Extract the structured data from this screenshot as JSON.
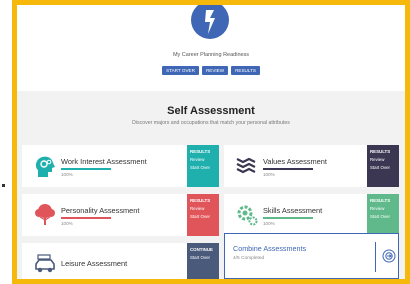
{
  "header": {
    "title": "My Career Planning Readiness",
    "buttons": [
      "START OVER",
      "REVIEW",
      "RESULTS"
    ]
  },
  "section": {
    "title": "Self Assessment",
    "subtitle": "Discover majors and occupations that match your personal attributes"
  },
  "cards": [
    {
      "name": "Work Interest Assessment",
      "pct": "100%",
      "side": [
        "RESULTS",
        "Review",
        "Start Over"
      ],
      "side_color": "#1fb0ad",
      "bar_color": "#1fb0ad"
    },
    {
      "name": "Values Assessment",
      "pct": "100%",
      "side": [
        "RESULTS",
        "Review",
        "Start Over"
      ],
      "side_color": "#3b3752",
      "bar_color": "#3b3752"
    },
    {
      "name": "Personality Assessment",
      "pct": "100%",
      "side": [
        "RESULTS",
        "Review",
        "Start Over"
      ],
      "side_color": "#e0555a",
      "bar_color": "#e0555a"
    },
    {
      "name": "Skills Assessment",
      "pct": "100%",
      "side": [
        "RESULTS",
        "Review",
        "Start Over"
      ],
      "side_color": "#5fb98a",
      "bar_color": "#5fb98a"
    },
    {
      "name": "Leisure Assessment",
      "pct": "",
      "side": [
        "CONTINUE",
        "Start Over"
      ],
      "side_color": "#4a5a7a",
      "bar_color": ""
    }
  ],
  "combine": {
    "title": "Combine Assessments",
    "subtitle": "4/5 Completed"
  },
  "colors": {
    "accent": "#3f67b6",
    "frame": "#f7b80c"
  },
  "icons": [
    "career-logo-icon",
    "head-gears-icon",
    "scales-icon",
    "brain-tree-icon",
    "gear-icon",
    "car-icon",
    "forward-arrow-icon"
  ]
}
